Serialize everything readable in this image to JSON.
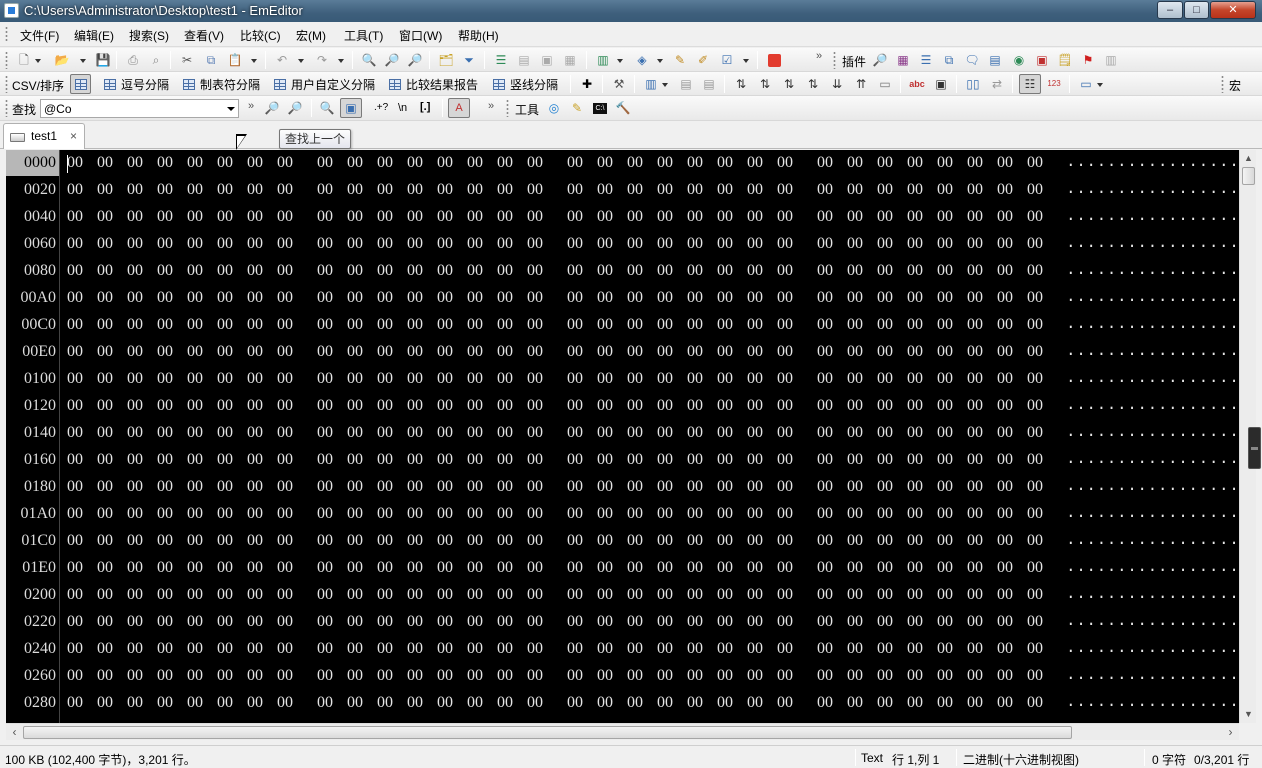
{
  "window": {
    "title": "C:\\Users\\Administrator\\Desktop\\test1 - EmEditor",
    "minimize": "‒",
    "maximize": "□",
    "close": "✕"
  },
  "menu": [
    "文件(F)",
    "编辑(E)",
    "搜索(S)",
    "查看(V)",
    "比较(C)",
    "宏(M)",
    "工具(T)",
    "窗口(W)",
    "帮助(H)"
  ],
  "toolbar1": {
    "plugins_label": "插件"
  },
  "csv_bar": {
    "label": "CSV/排序",
    "buttons": [
      "逗号分隔",
      "制表符分隔",
      "用户自定义分隔",
      "比较结果报告",
      "竖线分隔"
    ],
    "macro_label": "宏"
  },
  "find_bar": {
    "label": "查找",
    "value": "@Co",
    "tools_label": "工具",
    "regex_hint": ".+?",
    "newline_hint": "\\n",
    "brackets_hint": "[.]"
  },
  "tabs": [
    {
      "label": "test1",
      "close": "×"
    }
  ],
  "tooltip": "查找上一个",
  "editor": {
    "addresses": [
      "0000",
      "0020",
      "0040",
      "0060",
      "0080",
      "00A0",
      "00C0",
      "00E0",
      "0100",
      "0120",
      "0140",
      "0160",
      "0180",
      "01A0",
      "01C0",
      "01E0",
      "0200",
      "0220",
      "0240",
      "0260",
      "0280"
    ],
    "byte_value": "00",
    "bytes_per_row": 32,
    "ascii_row": "................................"
  },
  "statusbar": {
    "size": "100 KB (102,400 字节)，3,201 行。",
    "mode": "Text",
    "position": "行 1,列 1",
    "encoding": "二进制(十六进制视图)",
    "chars": "0 字符",
    "lines": "0/3,201 行"
  }
}
